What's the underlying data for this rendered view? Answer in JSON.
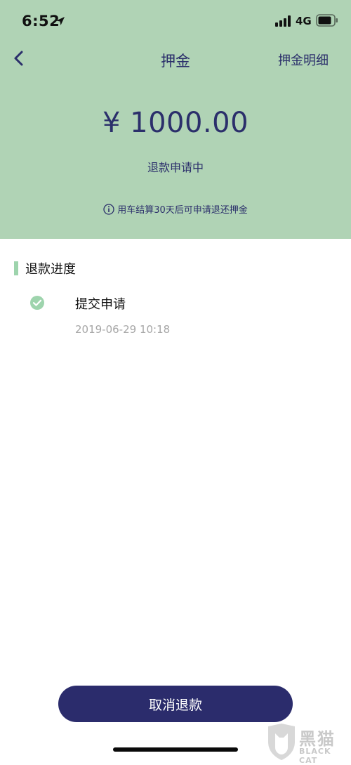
{
  "status_bar": {
    "time": "6:52",
    "network": "4G",
    "icons": [
      "location-arrow-icon",
      "signal-bars-icon",
      "battery-icon"
    ]
  },
  "nav": {
    "title": "押金",
    "right_link": "押金明细",
    "back_icon": "chevron-left-icon"
  },
  "deposit": {
    "amount": "¥ 1000.00",
    "status": "退款申请中",
    "notice": "用车结算30天后可申请退还押金",
    "notice_icon": "info-icon"
  },
  "progress": {
    "title": "退款进度",
    "steps": [
      {
        "label": "提交申请",
        "time": "2019-06-29 10:18",
        "icon": "check-circle-icon"
      }
    ]
  },
  "actions": {
    "cancel_label": "取消退款"
  },
  "watermark": {
    "cn": "黑猫",
    "en": "BLACK CAT"
  },
  "colors": {
    "header_bg": "#b0d3b5",
    "accent_navy": "#2b2c6c",
    "section_bar": "#9ed4ad",
    "check_green": "#9ed4ad",
    "muted_text": "#a6a6a6"
  }
}
